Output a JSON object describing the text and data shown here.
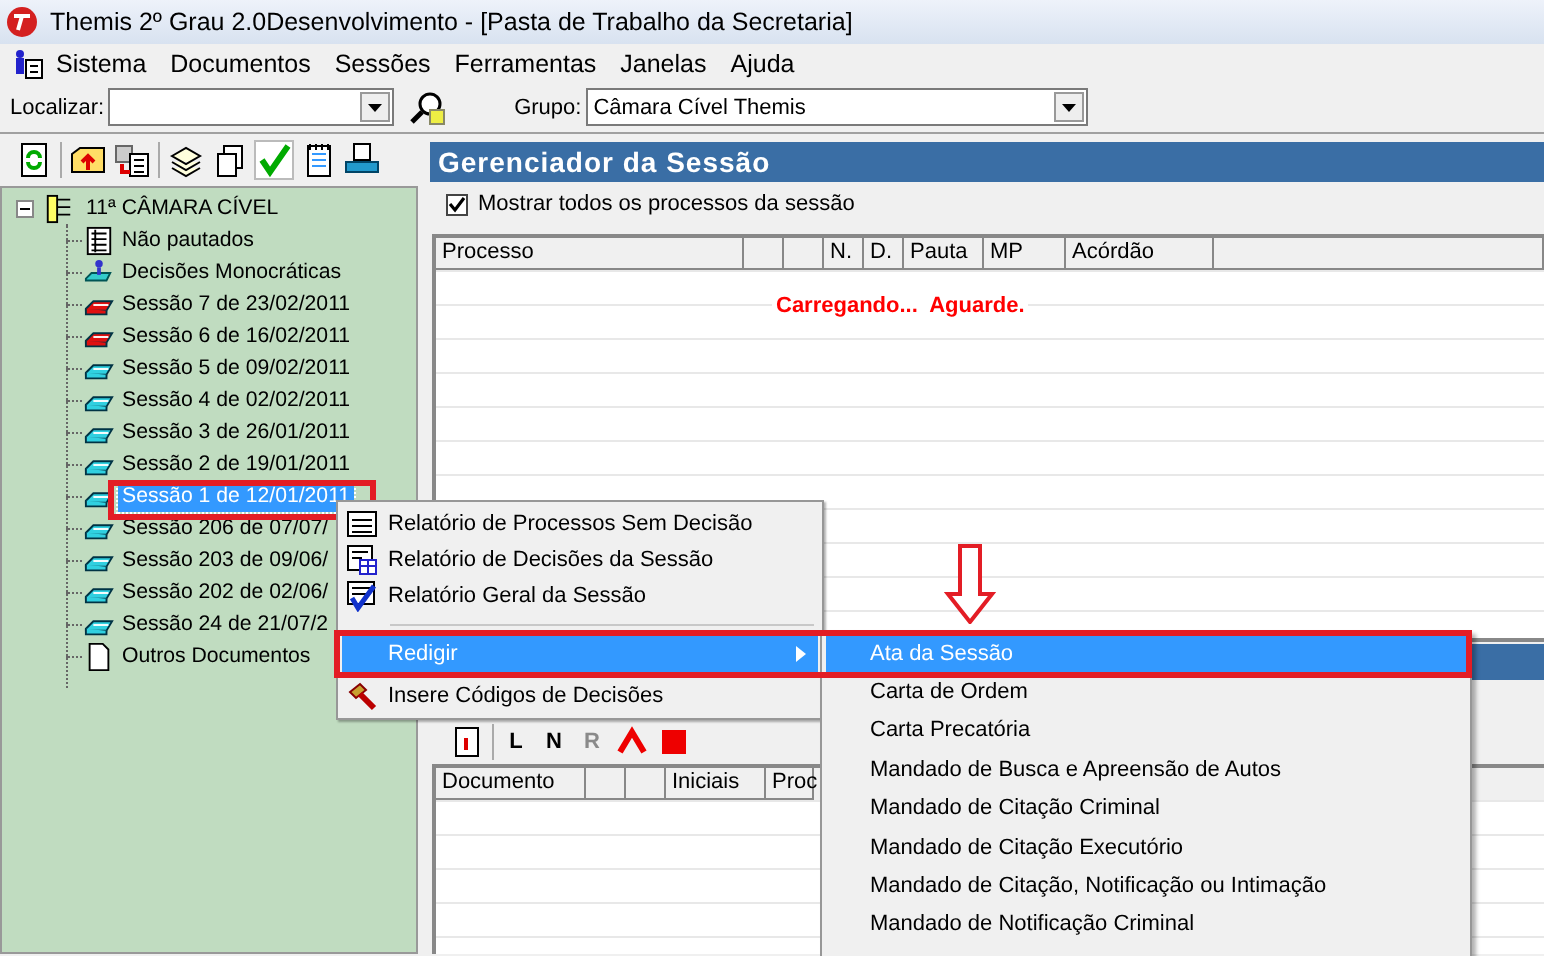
{
  "window": {
    "title": "Themis 2º Grau 2.0Desenvolvimento - [Pasta de Trabalho da Secretaria]"
  },
  "menu_bar": [
    "Sistema",
    "Documentos",
    "Sessões",
    "Ferramentas",
    "Janelas",
    "Ajuda"
  ],
  "search_bar": {
    "find_label": "Localizar:",
    "group_label": "Grupo:",
    "group_value": "Câmara Cível Themis"
  },
  "tree": {
    "label": "11ª CÂMARA CÍVEL",
    "expanded": true,
    "children": [
      {
        "label": "Não pautados",
        "kind": "list",
        "selected": false
      },
      {
        "label": "Decisões Monocráticas",
        "kind": "person",
        "selected": false
      },
      {
        "label": "Sessão 7 de 23/02/2011",
        "kind": "session-red",
        "selected": false
      },
      {
        "label": "Sessão 6 de 16/02/2011",
        "kind": "session-red",
        "selected": false
      },
      {
        "label": "Sessão 5 de 09/02/2011",
        "kind": "session",
        "selected": false
      },
      {
        "label": "Sessão 4 de 02/02/2011",
        "kind": "session",
        "selected": false
      },
      {
        "label": "Sessão 3 de 26/01/2011",
        "kind": "session",
        "selected": false
      },
      {
        "label": "Sessão 2 de 19/01/2011",
        "kind": "session",
        "selected": false
      },
      {
        "label": "Sessão 1 de 12/01/2011",
        "kind": "session",
        "selected": true
      },
      {
        "label": "Sessão 206 de 07/07/",
        "kind": "session",
        "selected": false
      },
      {
        "label": "Sessão 203 de 09/06/",
        "kind": "session",
        "selected": false
      },
      {
        "label": "Sessão 202 de 02/06/",
        "kind": "session",
        "selected": false
      },
      {
        "label": "Sessão 24 de 21/07/2",
        "kind": "session",
        "selected": false
      },
      {
        "label": "Outros Documentos",
        "kind": "page",
        "selected": false
      }
    ]
  },
  "session_manager": {
    "title": "Gerenciador da Sessão",
    "show_all": {
      "label": "Mostrar todos os processos da sessão",
      "checked": true
    },
    "columns": [
      {
        "kind": "text",
        "label": "Processo"
      },
      {
        "kind": "blank"
      },
      {
        "kind": "blank"
      },
      {
        "kind": "text",
        "label": "N."
      },
      {
        "kind": "text",
        "label": "D."
      },
      {
        "kind": "text",
        "label": "Pauta"
      },
      {
        "kind": "text",
        "label": "MP"
      },
      {
        "kind": "text",
        "label": "Acórdão"
      },
      {
        "kind": "blank"
      }
    ],
    "loading_message": "Carregando...  Aguarde."
  },
  "documents": {
    "toolbar_letters": [
      {
        "label": "L",
        "disabled": false
      },
      {
        "label": "N",
        "disabled": false
      },
      {
        "label": "R",
        "disabled": true
      }
    ],
    "columns": [
      {
        "kind": "text",
        "label": "Documento"
      },
      {
        "kind": "blank"
      },
      {
        "kind": "blank"
      },
      {
        "kind": "text",
        "label": "Iniciais"
      },
      {
        "kind": "text",
        "label": "Proc"
      }
    ]
  },
  "context_menu": {
    "items": [
      {
        "kind": "lines",
        "label": "Relatório de Processos Sem Decisão",
        "selected": false
      },
      {
        "kind": "grid",
        "label": "Relatório de Decisões da Sessão",
        "selected": false
      },
      {
        "kind": "check",
        "label": "Relatório Geral da Sessão",
        "selected": false
      },
      {
        "kind": "submenu",
        "label": "Redigir",
        "selected": true
      },
      {
        "kind": "hammer",
        "label": "Insere Códigos de Decisões",
        "selected": false
      }
    ]
  },
  "submenu": {
    "items": [
      {
        "label": "Ata da Sessão",
        "selected": true
      },
      {
        "label": "Carta de Ordem",
        "selected": false
      },
      {
        "label": "Carta Precatória",
        "selected": false
      },
      {
        "label": "Mandado de Busca e Apreensão de Autos",
        "selected": false
      },
      {
        "label": "Mandado de Citação Criminal",
        "selected": false
      },
      {
        "label": "Mandado de Citação Executório",
        "selected": false
      },
      {
        "label": "Mandado de Citação, Notificação ou Intimação",
        "selected": false
      },
      {
        "label": "Mandado de Notificação Criminal",
        "selected": false
      }
    ]
  }
}
